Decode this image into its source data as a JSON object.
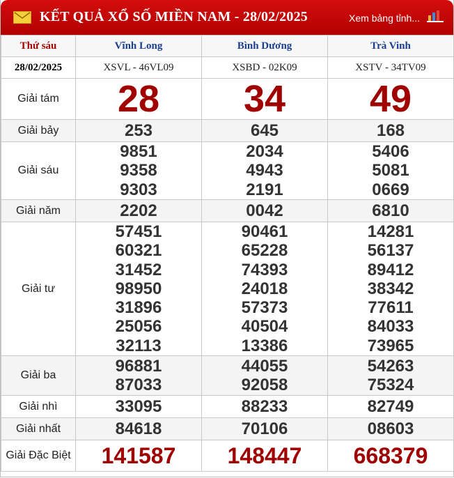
{
  "header": {
    "title": "KẾT QUẢ XỔ SỐ MIỀN NAM - 28/02/2025",
    "more_link": "Xem bảng tỉnh..."
  },
  "columns": {
    "day": "Thứ sáu",
    "date": "28/02/2025",
    "provinces": [
      {
        "name": "Vĩnh Long",
        "code": "XSVL - 46VL09"
      },
      {
        "name": "Bình Dương",
        "code": "XSBD - 02K09"
      },
      {
        "name": "Trà Vinh",
        "code": "XSTV - 34TV09"
      }
    ]
  },
  "prizes": {
    "g8": {
      "label": "Giải tám",
      "values": [
        "28",
        "34",
        "49"
      ]
    },
    "g7": {
      "label": "Giải bảy",
      "values": [
        "253",
        "645",
        "168"
      ]
    },
    "g6": {
      "label": "Giải sáu",
      "values": [
        [
          "9851",
          "9358",
          "9303"
        ],
        [
          "2034",
          "4943",
          "2191"
        ],
        [
          "5406",
          "5081",
          "0669"
        ]
      ]
    },
    "g5": {
      "label": "Giải năm",
      "values": [
        "2202",
        "0042",
        "6810"
      ]
    },
    "g4": {
      "label": "Giải tư",
      "values": [
        [
          "57451",
          "60321",
          "31452",
          "98950",
          "31896",
          "25056",
          "32113"
        ],
        [
          "90461",
          "65228",
          "74393",
          "24018",
          "57373",
          "40504",
          "13386"
        ],
        [
          "14281",
          "56137",
          "89412",
          "38342",
          "77611",
          "84033",
          "73965"
        ]
      ]
    },
    "g3": {
      "label": "Giải ba",
      "values": [
        [
          "96881",
          "87033"
        ],
        [
          "44055",
          "92058"
        ],
        [
          "54263",
          "75324"
        ]
      ]
    },
    "g2": {
      "label": "Giải nhì",
      "values": [
        "33095",
        "88233",
        "82749"
      ]
    },
    "g1": {
      "label": "Giải nhất",
      "values": [
        "84618",
        "70106",
        "08603"
      ]
    },
    "db": {
      "label": "Giải Đặc Biệt",
      "values": [
        "141587",
        "148447",
        "668379"
      ]
    }
  },
  "colors": {
    "header_red": "#c40505",
    "province_blue": "#1a3f8e",
    "prize_red": "#a00000"
  },
  "icons": [
    "envelope-icon",
    "bar-chart-icon"
  ]
}
